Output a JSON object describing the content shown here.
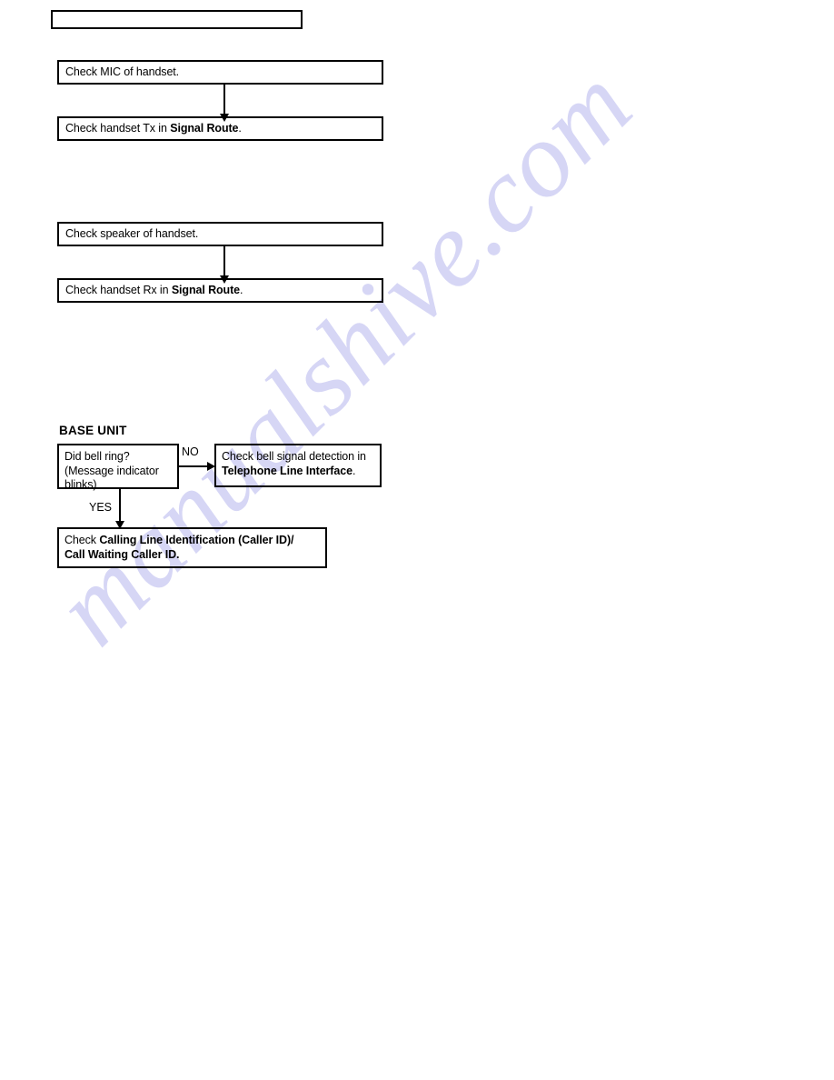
{
  "document": {
    "watermark": "manualshive.com",
    "header_box": {
      "text": ""
    }
  },
  "flow_sections": [
    {
      "id": "handset-tx",
      "boxes": [
        {
          "name": "check-mic-of-handset",
          "text": "Check MIC of handset."
        },
        {
          "name": "check-handset-tx",
          "prefix": "Check handset Tx in ",
          "bold": "Signal Route",
          "suffix": "."
        }
      ],
      "connector": "down-arrow"
    },
    {
      "id": "handset-rx",
      "boxes": [
        {
          "name": "check-speaker-of-handset",
          "text": "Check speaker of handset."
        },
        {
          "name": "check-handset-rx",
          "prefix": "Check handset Rx in ",
          "bold": "Signal Route",
          "suffix": "."
        }
      ],
      "connector": "down-arrow"
    }
  ],
  "base_unit": {
    "title": "BASE UNIT",
    "decision": {
      "line1": "Did bell ring?",
      "line2": "(Message indicator",
      "line3": "blinks)"
    },
    "branch_no_label": "NO",
    "branch_yes_label": "YES",
    "no_target": {
      "line1": "Check bell signal detection in",
      "line2_bold": "Telephone Line Interface",
      "line2_suffix": "."
    },
    "yes_target": {
      "prefix": "Check ",
      "bold_line1": "Calling Line Identification (Caller ID)/",
      "bold_line2": "Call Waiting Caller ID."
    }
  }
}
